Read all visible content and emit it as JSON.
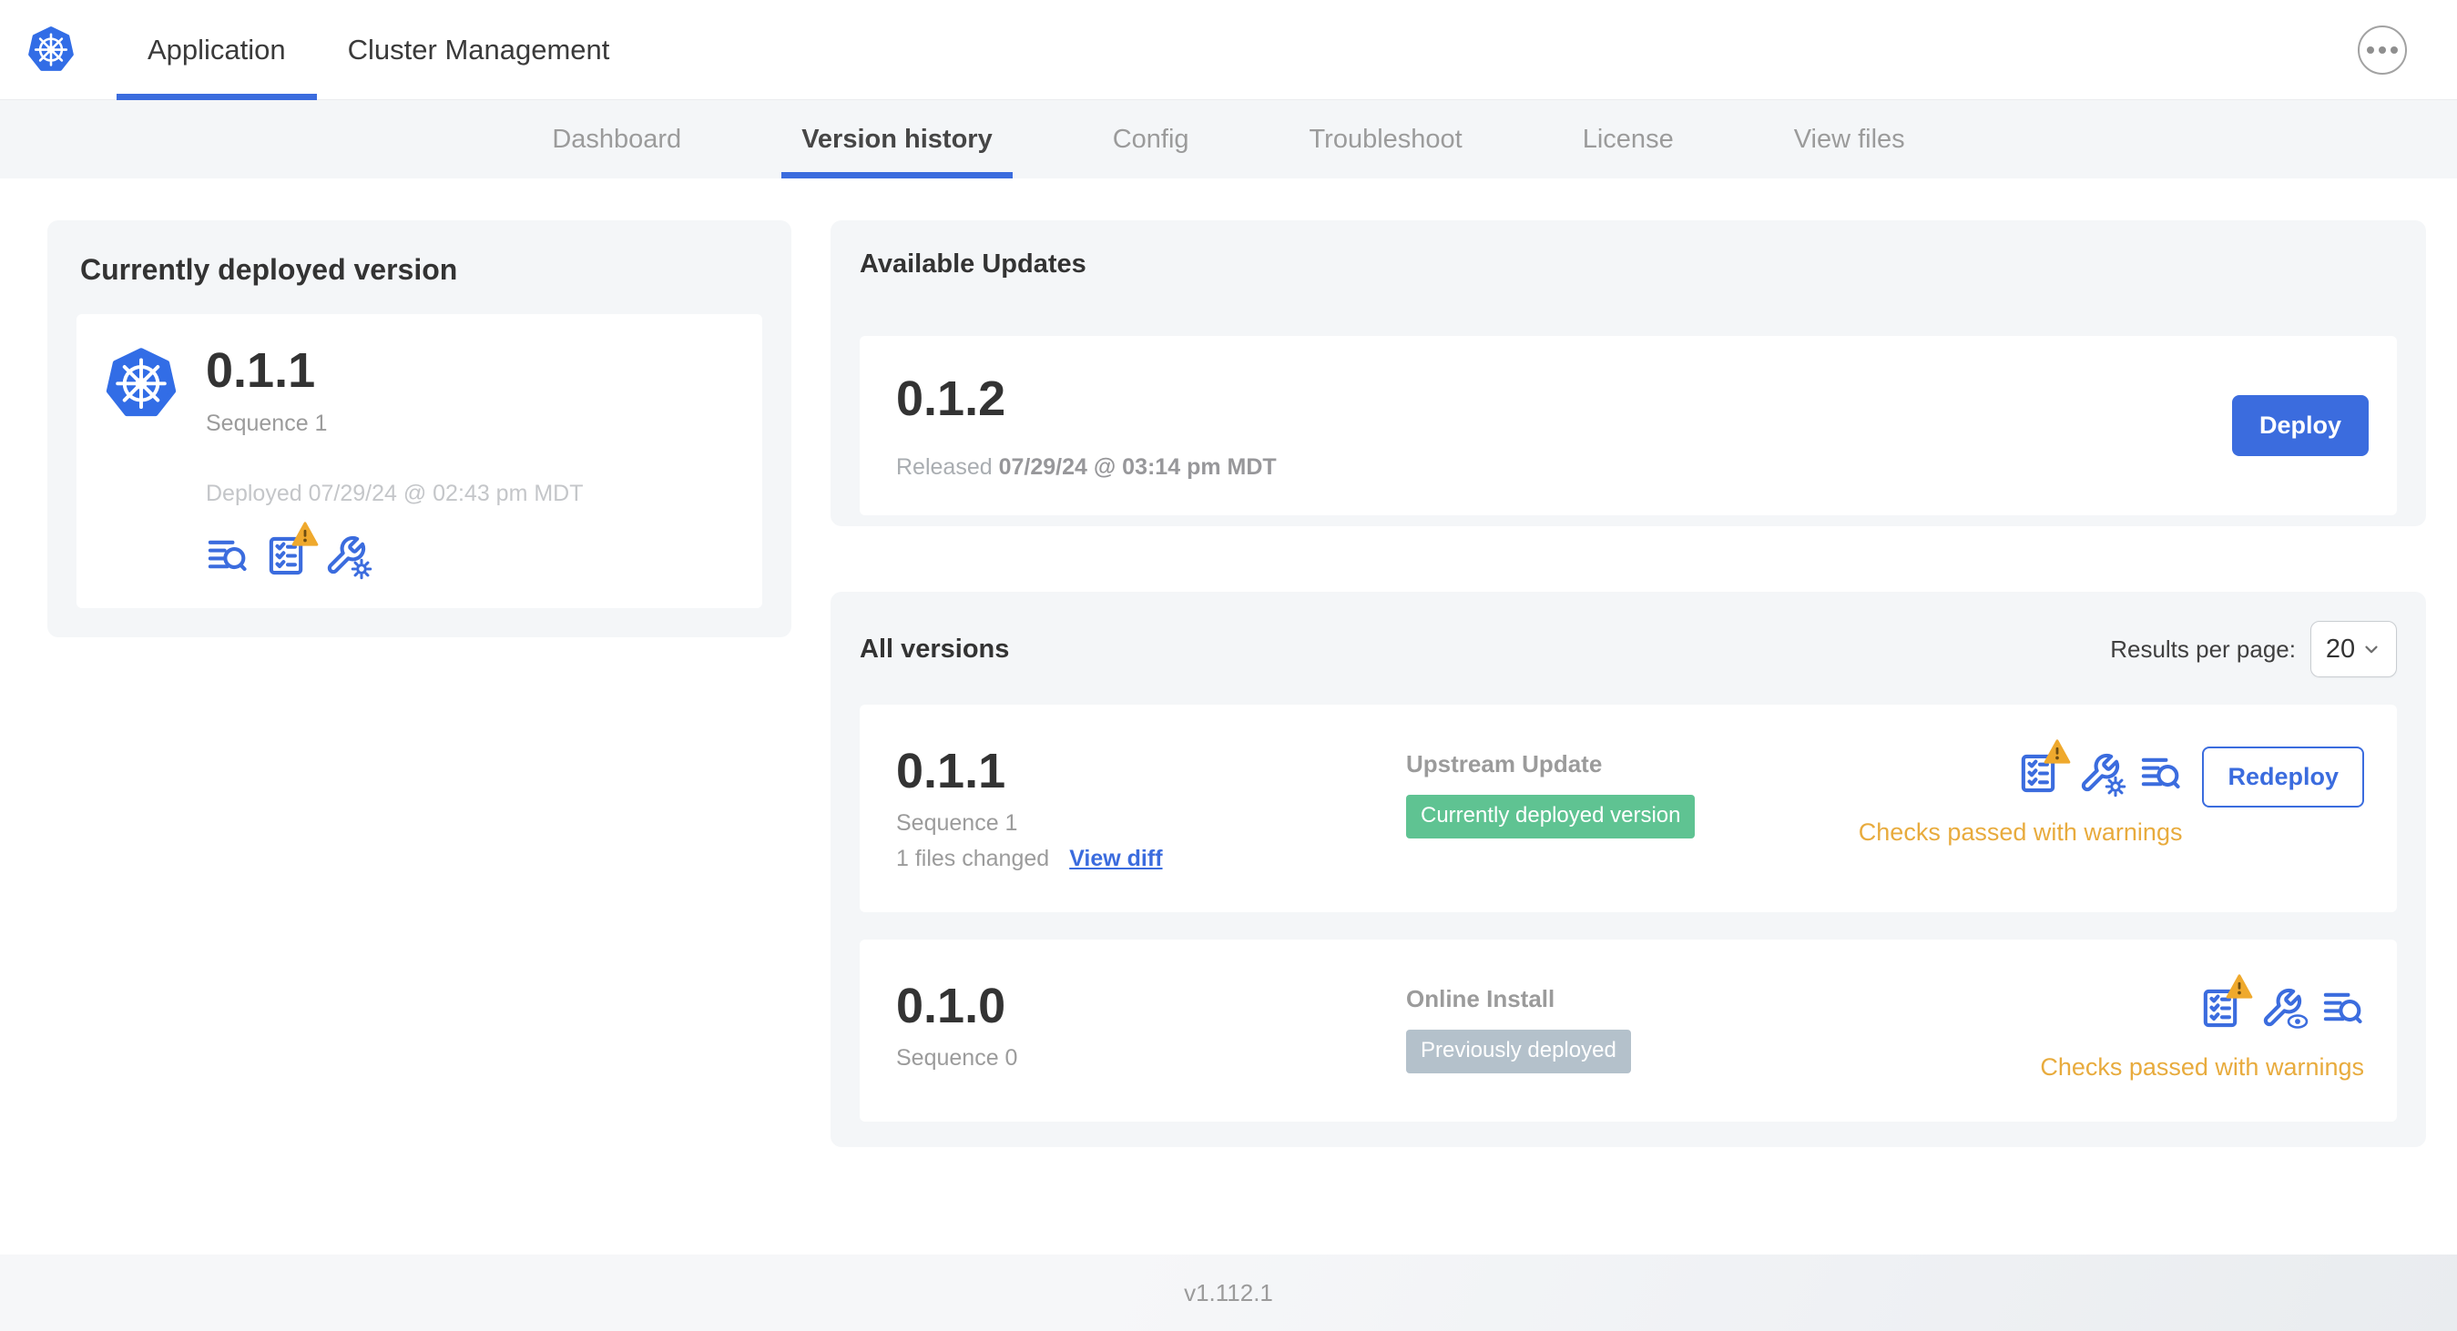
{
  "colors": {
    "accent_blue": "#3b6cde",
    "kubernetes_blue": "#326de6",
    "badge_green": "#5fc392",
    "badge_gray": "#b4c1cb",
    "warning_amber": "#e8ab3d",
    "card_background": "#f4f6f8"
  },
  "header": {
    "tabs": [
      {
        "label": "Application",
        "active": true
      },
      {
        "label": "Cluster Management",
        "active": false
      }
    ],
    "overflow_menu_icon": "ellipsis-icon",
    "logo_icon": "kubernetes-logo"
  },
  "subnav": {
    "tabs": [
      {
        "label": "Dashboard",
        "active": false
      },
      {
        "label": "Version history",
        "active": true
      },
      {
        "label": "Config",
        "active": false
      },
      {
        "label": "Troubleshoot",
        "active": false
      },
      {
        "label": "License",
        "active": false
      },
      {
        "label": "View files",
        "active": false
      }
    ]
  },
  "deployed_card": {
    "title": "Currently deployed version",
    "app_icon": "kubernetes-logo",
    "version": "0.1.1",
    "sequence": "Sequence 1",
    "deployed_at": "Deployed 07/29/24 @ 02:43 pm MDT",
    "icons": [
      "release-notes-icon",
      "preflight-checks-warning-icon",
      "edit-config-icon"
    ]
  },
  "available_updates": {
    "title": "Available Updates",
    "version": "0.1.2",
    "released_prefix": "Released",
    "released_at": "07/29/24 @ 03:14 pm MDT",
    "deploy_button": "Deploy"
  },
  "all_versions": {
    "title": "All versions",
    "results_per_page_label": "Results per page:",
    "results_per_page_value": "20",
    "rows": [
      {
        "version": "0.1.1",
        "sequence": "Sequence 1",
        "files_changed": "1 files changed",
        "view_diff": "View diff",
        "source": "Upstream Update",
        "badge": "Currently deployed version",
        "badge_style": "green",
        "icons": [
          "preflight-checks-warning-icon",
          "edit-config-icon",
          "release-notes-icon"
        ],
        "status": "Checks passed with warnings",
        "action_button": "Redeploy"
      },
      {
        "version": "0.1.0",
        "sequence": "Sequence 0",
        "source": "Online Install",
        "badge": "Previously deployed",
        "badge_style": "gray",
        "icons": [
          "preflight-checks-warning-icon",
          "view-config-icon",
          "release-notes-icon"
        ],
        "status": "Checks passed with warnings"
      }
    ]
  },
  "footer": {
    "app_version": "v1.112.1"
  }
}
